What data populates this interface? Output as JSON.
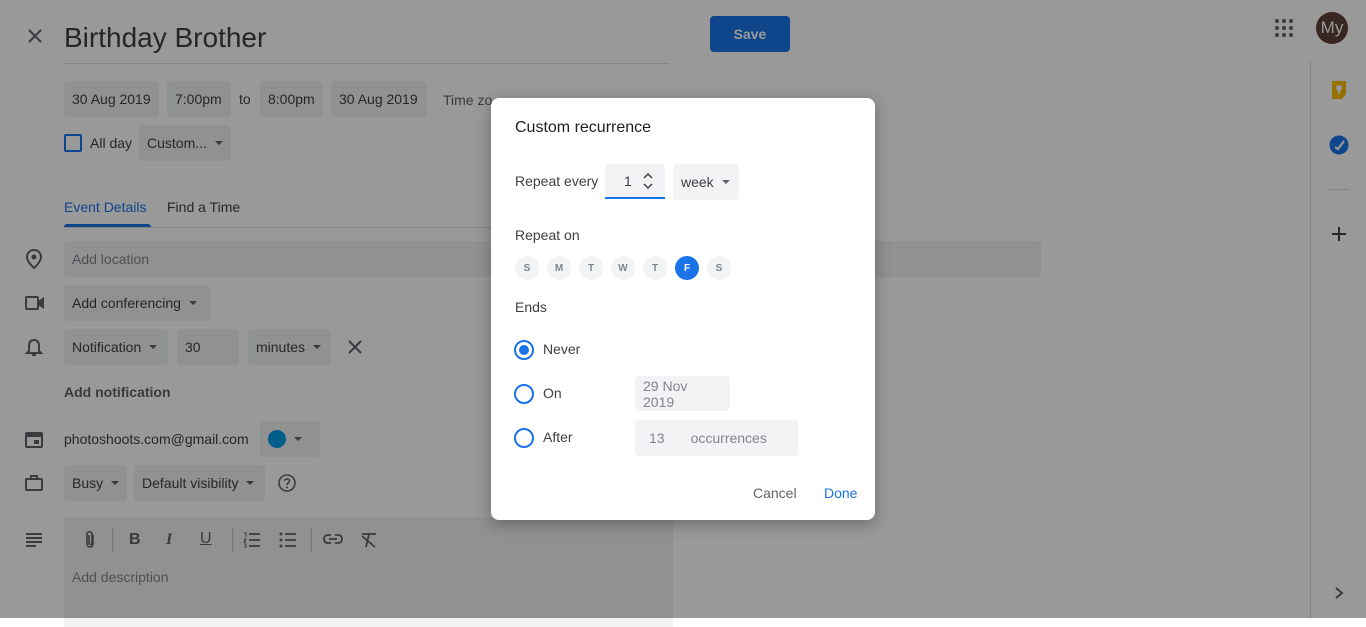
{
  "event": {
    "title": "Birthday Brother",
    "save_label": "Save",
    "start_date": "30 Aug 2019",
    "start_time": "7:00pm",
    "to_label": "to",
    "end_time": "8:00pm",
    "end_date": "30 Aug 2019",
    "time_zone_label": "Time zo",
    "all_day_label": "All day",
    "recurrence_value": "Custom..."
  },
  "account": {
    "avatar_initials": "My"
  },
  "tabs": [
    {
      "label": "Event Details",
      "active": true
    },
    {
      "label": "Find a Time",
      "active": false
    }
  ],
  "details": {
    "location_placeholder": "Add location",
    "conferencing_label": "Add conferencing",
    "notification_type": "Notification",
    "notification_amount": "30",
    "notification_unit": "minutes",
    "add_notification_label": "Add notification",
    "calendar_email": "photoshoots.com@gmail.com",
    "calendar_color": "#039be5",
    "busy_label": "Busy",
    "visibility_label": "Default visibility",
    "description_placeholder": "Add description"
  },
  "dialog": {
    "title": "Custom recurrence",
    "repeat_every_label": "Repeat every",
    "repeat_interval": "1",
    "repeat_unit": "week",
    "repeat_on_label": "Repeat on",
    "days": [
      {
        "letter": "S",
        "selected": false
      },
      {
        "letter": "M",
        "selected": false
      },
      {
        "letter": "T",
        "selected": false
      },
      {
        "letter": "W",
        "selected": false
      },
      {
        "letter": "T",
        "selected": false
      },
      {
        "letter": "F",
        "selected": true
      },
      {
        "letter": "S",
        "selected": false
      }
    ],
    "ends_label": "Ends",
    "never_label": "Never",
    "on_label": "On",
    "on_date": "29 Nov 2019",
    "after_label": "After",
    "after_count": "13",
    "occurrences_label": "occurrences",
    "selected_end_option": "Never",
    "cancel_label": "Cancel",
    "done_label": "Done"
  },
  "colors": {
    "accent": "#1a73e8",
    "save_button": "#1a73e8",
    "avatar_bg": "#5d4037",
    "keep_icon": "#fbbc04",
    "tasks_icon": "#1a73e8"
  },
  "icons": [
    "close-icon",
    "apps-grid-icon",
    "location-icon",
    "video-icon",
    "bell-icon",
    "calendar-icon",
    "briefcase-icon",
    "help-icon",
    "description-icon",
    "attachment-icon",
    "bold-icon",
    "italic-icon",
    "underline-icon",
    "numbered-list-icon",
    "bulleted-list-icon",
    "link-icon",
    "remove-format-icon",
    "keep-icon",
    "tasks-icon",
    "plus-icon",
    "chevron-right-icon"
  ]
}
